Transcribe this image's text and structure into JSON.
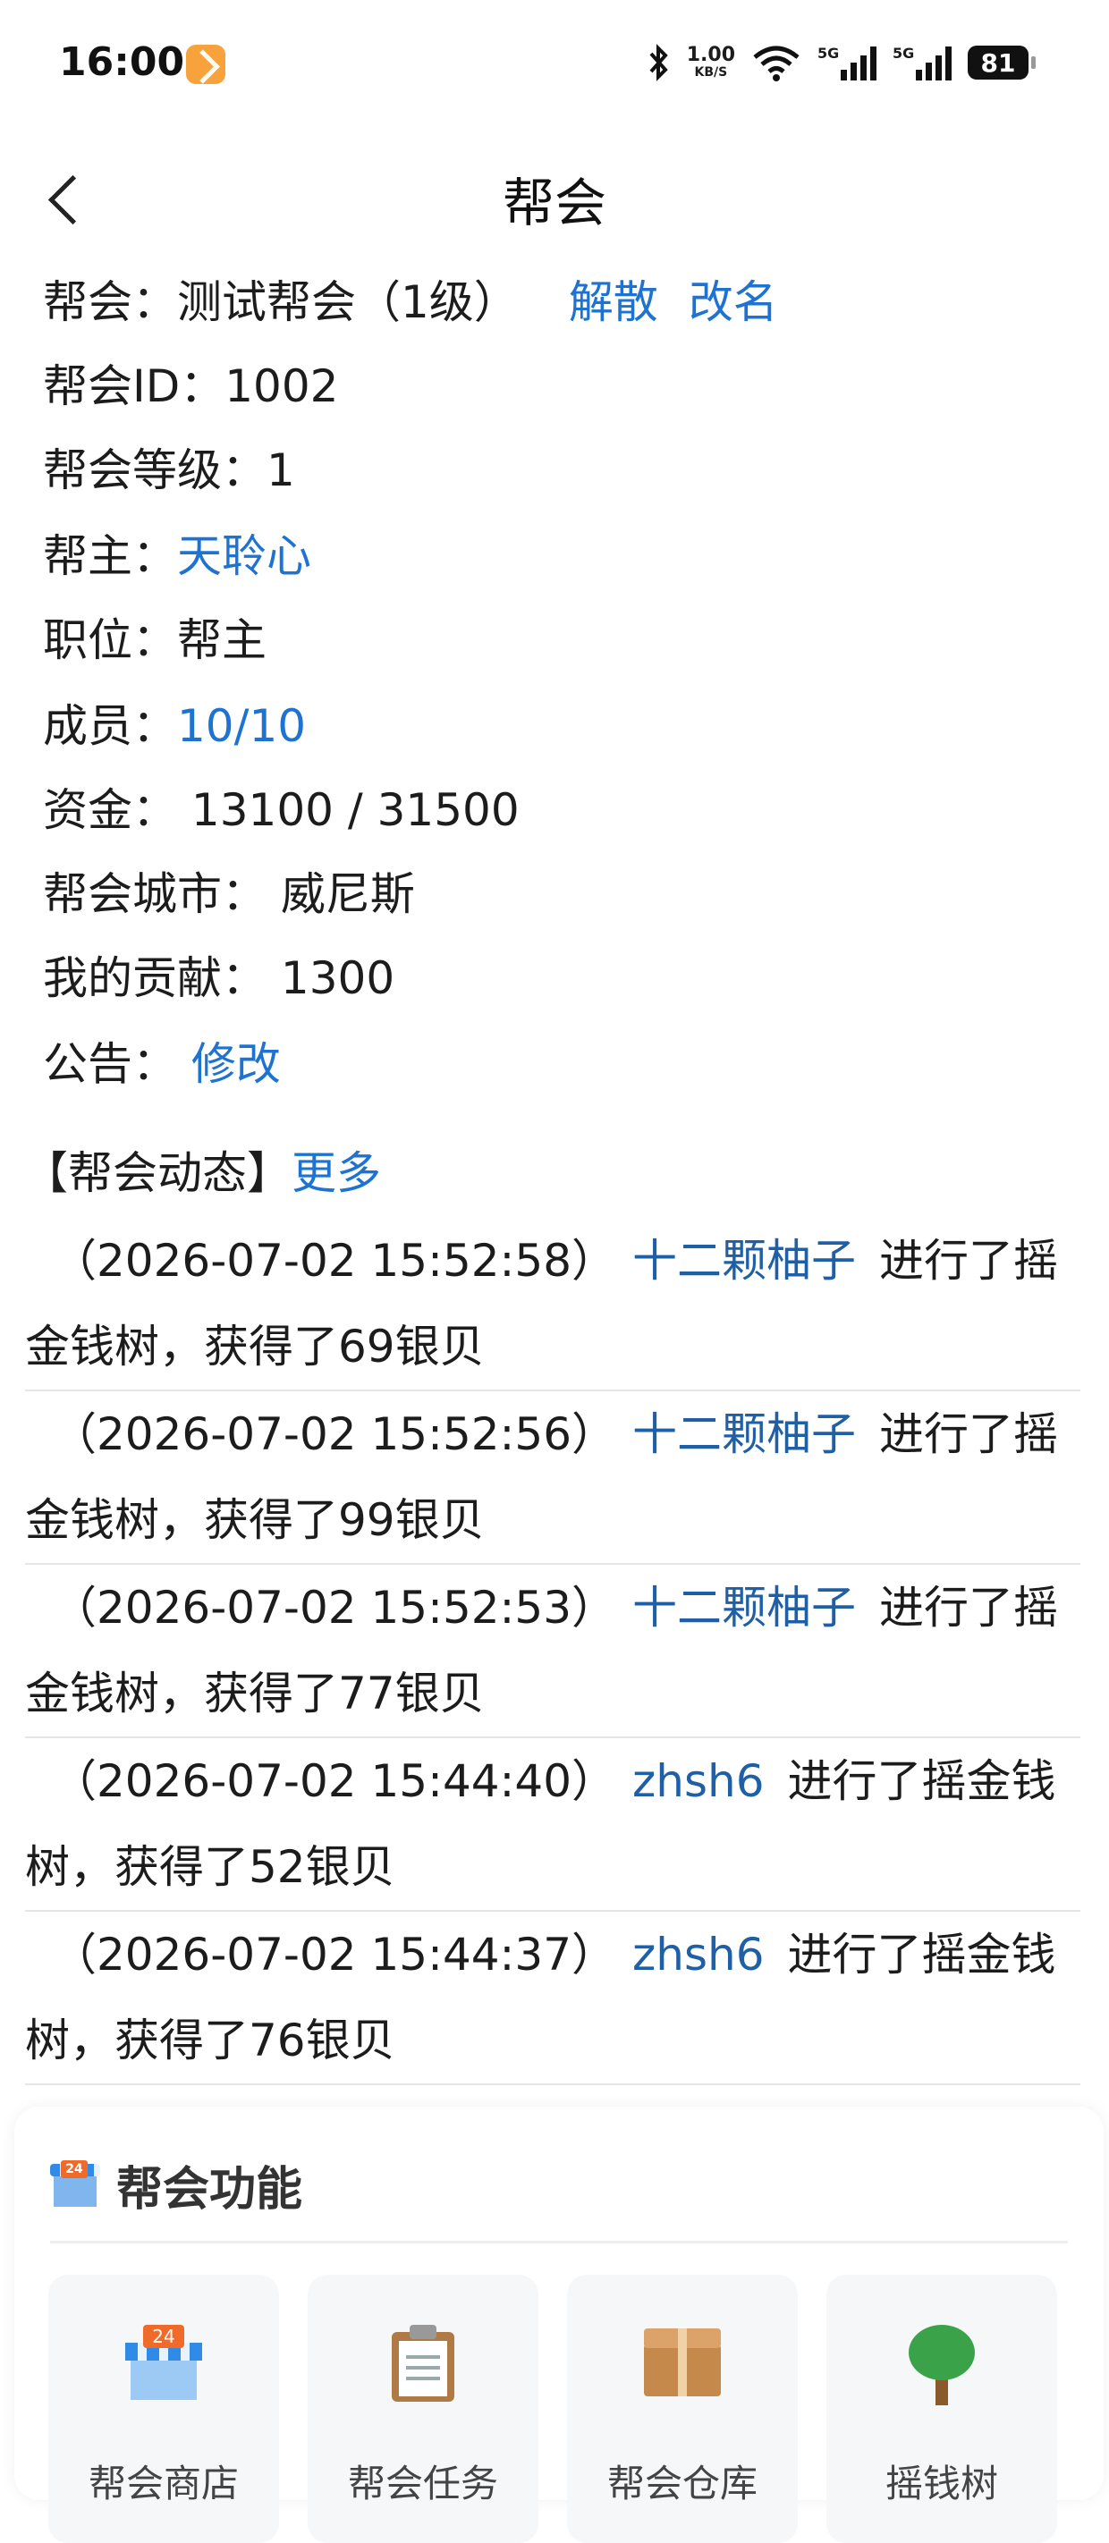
{
  "status_bar": {
    "time": "16:00",
    "speed_value": "1.00",
    "speed_unit": "KB/S",
    "signal1_label": "5G",
    "signal2_label": "5G",
    "battery": "81",
    "icons": [
      "app-badge-icon",
      "bluetooth-icon",
      "wifi-icon",
      "signal-icon",
      "battery-icon"
    ]
  },
  "header": {
    "title": "帮会",
    "back_icon": "chevron-left-icon"
  },
  "guild": {
    "name_label": "帮会：",
    "name_value": "测试帮会（1级）",
    "disband": "解散",
    "rename": "改名",
    "id_label": "帮会ID：",
    "id_value": "1002",
    "level_label": "帮会等级：",
    "level_value": "1",
    "leader_label": "帮主：",
    "leader_value": "天聆心",
    "position_label": "职位：",
    "position_value": "帮主",
    "members_label": "成员：",
    "members_value": "10/10",
    "funds_label": "资金：",
    "funds_value": "13100 / 31500",
    "city_label": "帮会城市：",
    "city_value": "威尼斯",
    "contribution_label": "我的贡献：",
    "contribution_value": "1300",
    "notice_label": "公告：",
    "notice_edit": "修改"
  },
  "activity": {
    "heading": "【帮会动态】",
    "more": "更多",
    "items": [
      {
        "time": "（2026-07-02 15:52:58）",
        "user": "十二颗柚子",
        "text": "进行了摇金钱树，获得了69银贝"
      },
      {
        "time": "（2026-07-02 15:52:56）",
        "user": "十二颗柚子",
        "text": "进行了摇金钱树，获得了99银贝"
      },
      {
        "time": "（2026-07-02 15:52:53）",
        "user": "十二颗柚子",
        "text": "进行了摇金钱树，获得了77银贝"
      },
      {
        "time": "（2026-07-02 15:44:40）",
        "user": "zhsh6",
        "text": "进行了摇金钱树，获得了52银贝"
      },
      {
        "time": "（2026-07-02 15:44:37）",
        "user": "zhsh6",
        "text": "进行了摇金钱树，获得了76银贝"
      }
    ]
  },
  "functions": {
    "title": "帮会功能",
    "title_icon": "convenience-store-icon",
    "tiles": [
      {
        "label": "帮会商店",
        "icon": "convenience-store-icon"
      },
      {
        "label": "帮会任务",
        "icon": "clipboard-icon"
      },
      {
        "label": "帮会仓库",
        "icon": "package-icon"
      },
      {
        "label": "摇钱树",
        "icon": "tree-icon"
      }
    ]
  },
  "colors": {
    "link": "#1e73d2",
    "user_link": "#1f5fa6",
    "text": "#1c1c1c",
    "app_badge": "#f7a23a"
  }
}
